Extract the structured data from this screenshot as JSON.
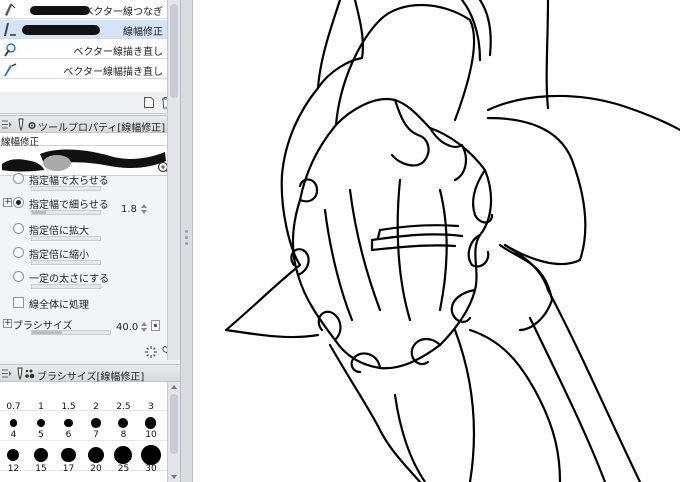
{
  "subtools": {
    "items": [
      {
        "label": "ベクター線つなぎ",
        "icon": "vector-connect-icon",
        "selected": false
      },
      {
        "label": "線幅修正",
        "icon": "line-width-icon",
        "selected": true
      },
      {
        "label": "ベクター線描き直し",
        "icon": "vector-redraw-icon",
        "selected": false
      },
      {
        "label": "ベクター線幅描き直し",
        "icon": "vector-width-redraw-icon",
        "selected": false
      }
    ],
    "footer": {
      "new_icon": "new-page-icon",
      "delete_icon": "trash-icon"
    }
  },
  "tool_property": {
    "title": "ツールプロパティ[線幅修正]",
    "tool_name": "線幅修正",
    "options": [
      {
        "label": "指定幅で太らせる",
        "selected": false,
        "value": ""
      },
      {
        "label": "指定幅で細らせる",
        "selected": true,
        "value": "1.8"
      },
      {
        "label": "指定倍に拡大",
        "selected": false,
        "value": ""
      },
      {
        "label": "指定倍に縮小",
        "selected": false,
        "value": ""
      },
      {
        "label": "一定の太さにする",
        "selected": false,
        "value": ""
      }
    ],
    "whole_line": {
      "label": "線全体に処理",
      "checked": false
    },
    "brush_size": {
      "label": "ブラシサイズ",
      "value": "40.0"
    }
  },
  "brush_size_palette": {
    "title": "ブラシサイズ[線幅修正]",
    "rows": [
      [
        "0.7",
        "1",
        "1.5",
        "2",
        "2.5",
        "3"
      ],
      [
        "4",
        "5",
        "6",
        "7",
        "8",
        "10"
      ],
      [
        "12",
        "15",
        "17",
        "20",
        "25",
        "30"
      ]
    ]
  },
  "colors": {
    "selected_row": "#d4e3f7",
    "panel_bg": "#eef0f3"
  }
}
